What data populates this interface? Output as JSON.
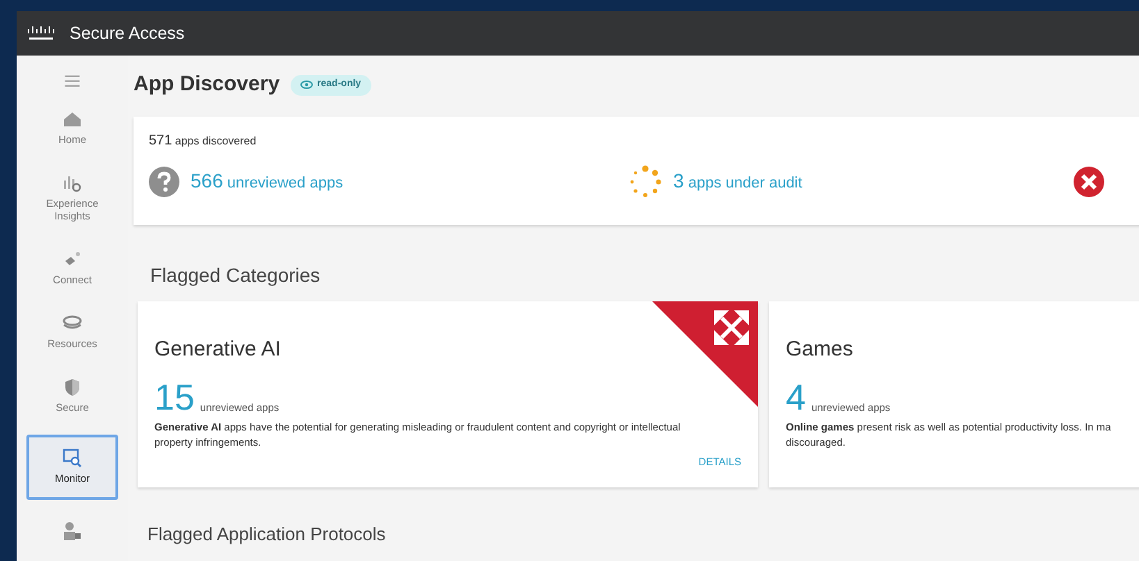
{
  "app": {
    "brand": "Secure Access"
  },
  "sidebar": {
    "items": [
      {
        "label": "Home",
        "selected": false
      },
      {
        "label": "Experience Insights",
        "selected": false
      },
      {
        "label": "Connect",
        "selected": false
      },
      {
        "label": "Resources",
        "selected": false
      },
      {
        "label": "Secure",
        "selected": false
      },
      {
        "label": "Monitor",
        "selected": true
      },
      {
        "selected": false
      }
    ]
  },
  "page": {
    "title": "App Discovery",
    "badge": "read-only"
  },
  "summary": {
    "count": "571",
    "label": "apps discovered",
    "stats": [
      {
        "kind": "unreviewed",
        "count": "566",
        "label": "unreviewed apps"
      },
      {
        "kind": "audit",
        "count": "3",
        "label": "apps under audit"
      },
      {
        "kind": "blocked"
      }
    ]
  },
  "flagged_categories": {
    "heading": "Flagged Categories",
    "cards": [
      {
        "title": "Generative AI",
        "count": "15",
        "count_label": "unreviewed apps",
        "description_lines": [
          "**Generative AI** apps have the potential for generating misleading or fraudulent content and copyright or intellectual",
          "property infringements."
        ],
        "corner_flag": true,
        "link": "DETAILS"
      },
      {
        "title": "Games",
        "count": "4",
        "count_label": "unreviewed apps",
        "description_lines": [
          "**Online games** present risk as well as potential productivity loss. In ma",
          "discouraged."
        ]
      }
    ]
  },
  "flagged_protocols": {
    "heading": "Flagged Application Protocols"
  }
}
